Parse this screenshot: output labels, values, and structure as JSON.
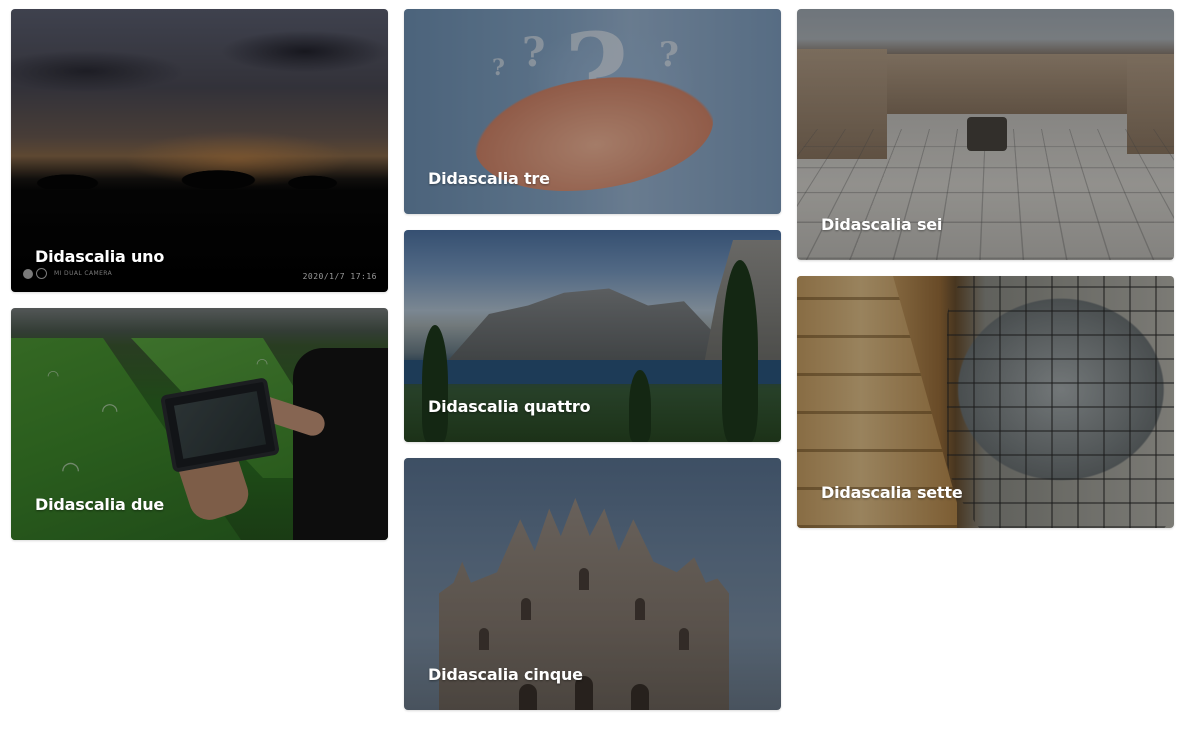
{
  "gallery": {
    "items": [
      {
        "caption": "Didascalia uno",
        "stamp": "2020/1/7  17:16",
        "camera_mark": "MI DUAL CAMERA"
      },
      {
        "caption": "Didascalia due"
      },
      {
        "caption": "Didascalia tre"
      },
      {
        "caption": "Didascalia quattro"
      },
      {
        "caption": "Didascalia cinque"
      },
      {
        "caption": "Didascalia sei"
      },
      {
        "caption": "Didascalia sette"
      }
    ]
  },
  "colors": {
    "caption_text": "#ffffff",
    "overlay": "rgba(0,0,0,0.32)",
    "page_background": "#ffffff"
  }
}
